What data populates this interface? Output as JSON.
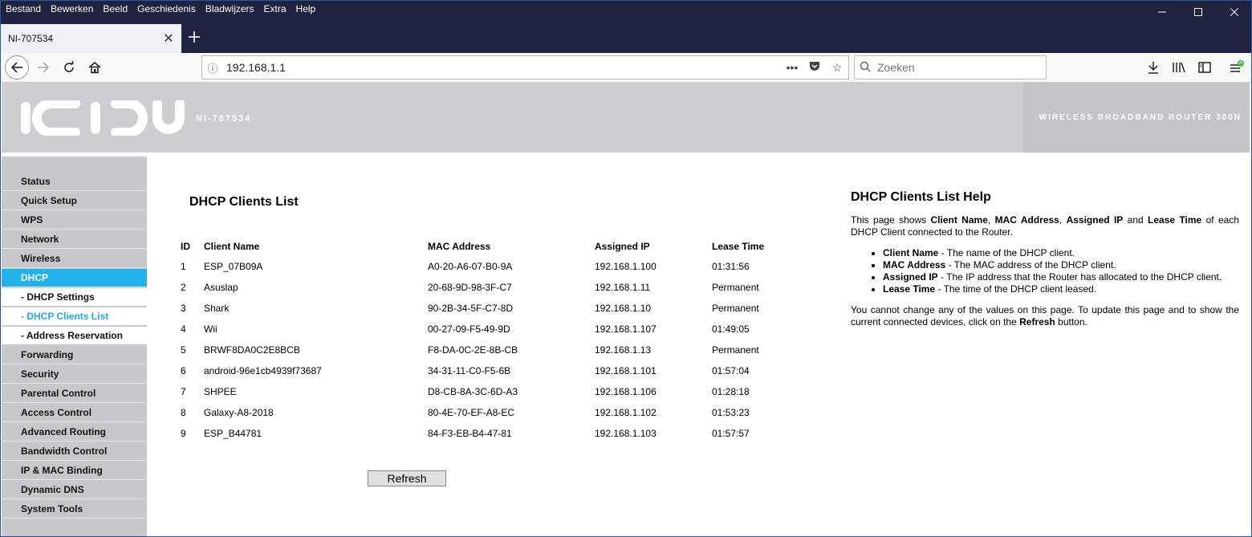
{
  "browser": {
    "menu": [
      "Bestand",
      "Bewerken",
      "Beeld",
      "Geschiedenis",
      "Bladwijzers",
      "Extra",
      "Help"
    ],
    "tab_title": "NI-707534",
    "url": "192.168.1.1",
    "search_placeholder": "Zoeken"
  },
  "banner": {
    "logo_text": "ICIDU",
    "model": "NI-707534",
    "tagline": "WIRELESS BROADBAND ROUTER 300N"
  },
  "sidebar": {
    "items": [
      {
        "label": "Status"
      },
      {
        "label": "Quick Setup"
      },
      {
        "label": "WPS"
      },
      {
        "label": "Network"
      },
      {
        "label": "Wireless"
      },
      {
        "label": "DHCP"
      },
      {
        "label": "- DHCP Settings"
      },
      {
        "label": "- DHCP Clients List"
      },
      {
        "label": "- Address Reservation"
      },
      {
        "label": "Forwarding"
      },
      {
        "label": "Security"
      },
      {
        "label": "Parental Control"
      },
      {
        "label": "Access Control"
      },
      {
        "label": "Advanced Routing"
      },
      {
        "label": "Bandwidth Control"
      },
      {
        "label": "IP & MAC Binding"
      },
      {
        "label": "Dynamic DNS"
      },
      {
        "label": "System Tools"
      }
    ]
  },
  "main": {
    "title": "DHCP Clients List",
    "columns": [
      "ID",
      "Client Name",
      "MAC Address",
      "Assigned IP",
      "Lease Time"
    ],
    "rows": [
      [
        "1",
        "ESP_07B09A",
        "A0-20-A6-07-B0-9A",
        "192.168.1.100",
        "01:31:56"
      ],
      [
        "2",
        "Asuslap",
        "20-68-9D-98-3F-C7",
        "192.168.1.11",
        "Permanent"
      ],
      [
        "3",
        "Shark",
        "90-2B-34-5F-C7-8D",
        "192.168.1.10",
        "Permanent"
      ],
      [
        "4",
        "Wii",
        "00-27-09-F5-49-9D",
        "192.168.1.107",
        "01:49:05"
      ],
      [
        "5",
        "BRWF8DA0C2E8BCB",
        "F8-DA-0C-2E-8B-CB",
        "192.168.1.13",
        "Permanent"
      ],
      [
        "6",
        "android-96e1cb4939f73687",
        "34-31-11-C0-F5-6B",
        "192.168.1.101",
        "01:57:04"
      ],
      [
        "7",
        "SHPEE",
        "D8-CB-8A-3C-6D-A3",
        "192.168.1.106",
        "01:28:18"
      ],
      [
        "8",
        "Galaxy-A8-2018",
        "80-4E-70-EF-A8-EC",
        "192.168.1.102",
        "01:53:23"
      ],
      [
        "9",
        "ESP_B44781",
        "84-F3-EB-B4-47-81",
        "192.168.1.103",
        "01:57:57"
      ]
    ],
    "refresh_label": "Refresh"
  },
  "help": {
    "title": "DHCP Clients List Help",
    "intro": {
      "t1": "This page shows ",
      "b1": "Client Name",
      "t2": ", ",
      "b2": "MAC Address",
      "t3": ", ",
      "b3": "Assigned IP",
      "t4": " and ",
      "b4": "Lease Time",
      "t5": " of each DHCP Client connected to the Router."
    },
    "bullets": [
      {
        "term": "Client Name",
        "desc": " - The name of the DHCP client."
      },
      {
        "term": "MAC Address",
        "desc": " - The MAC address of the DHCP client."
      },
      {
        "term": "Assigned IP",
        "desc": " - The IP address that the Router has allocated to the DHCP client."
      },
      {
        "term": "Lease Time",
        "desc": " - The time of the DHCP client leased."
      }
    ],
    "footer": {
      "t1": "You cannot change any of the values on this page. To update this page and to show the current connected devices, click on the ",
      "b1": "Refresh",
      "t2": " button."
    }
  }
}
